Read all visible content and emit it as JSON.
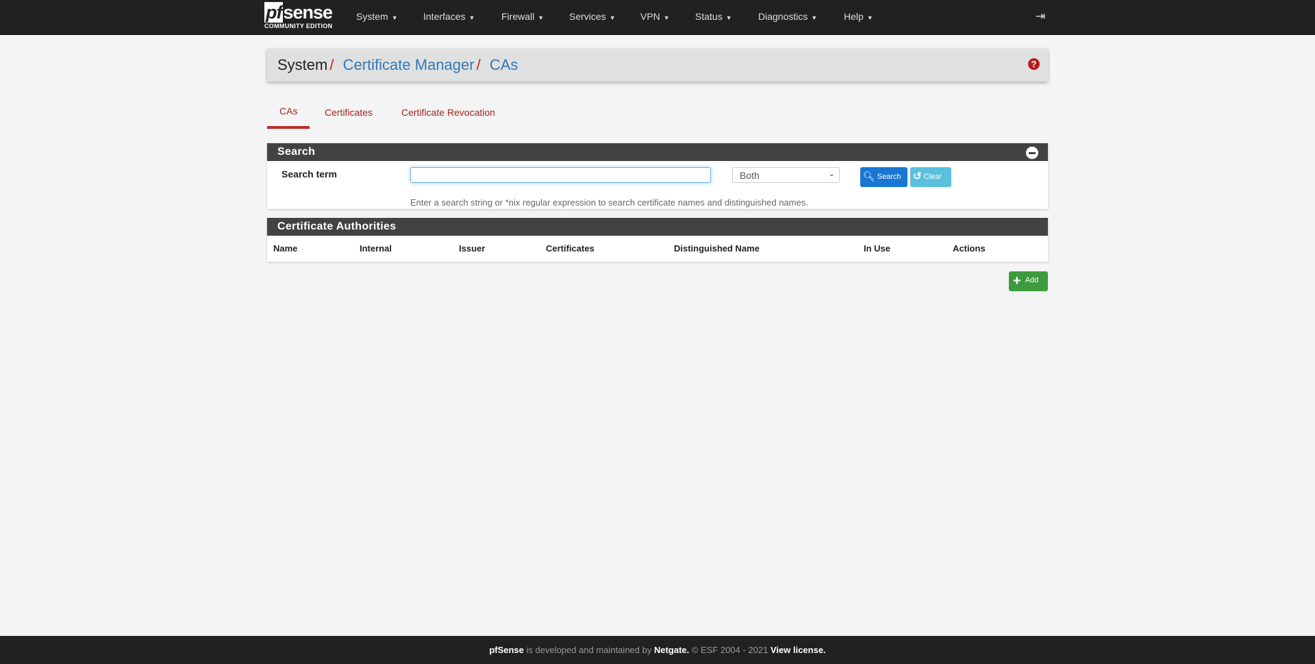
{
  "brand": {
    "logo": "pfsense",
    "edition": "COMMUNITY EDITION"
  },
  "nav": [
    "System",
    "Interfaces",
    "Firewall",
    "Services",
    "VPN",
    "Status",
    "Diagnostics",
    "Help"
  ],
  "breadcrumb": {
    "root": "System",
    "section": "Certificate Manager",
    "page": "CAs",
    "sep": "/"
  },
  "tabs": [
    "CAs",
    "Certificates",
    "Certificate Revocation"
  ],
  "search": {
    "title": "Search",
    "label": "Search term",
    "value": "",
    "select": "Both",
    "search_btn": "Search",
    "clear_btn": "Clear",
    "hint": "Enter a search string or *nix regular expression to search certificate names and distinguished names."
  },
  "ca": {
    "title": "Certificate Authorities",
    "columns": [
      "Name",
      "Internal",
      "Issuer",
      "Certificates",
      "Distinguished Name",
      "In Use",
      "Actions"
    ],
    "add": "Add"
  },
  "footer": {
    "brand": "pfSense",
    "text1": " is developed and maintained by ",
    "company": "Netgate.",
    "text2": " © ESF 2004 - 2021 ",
    "license": "View license."
  }
}
